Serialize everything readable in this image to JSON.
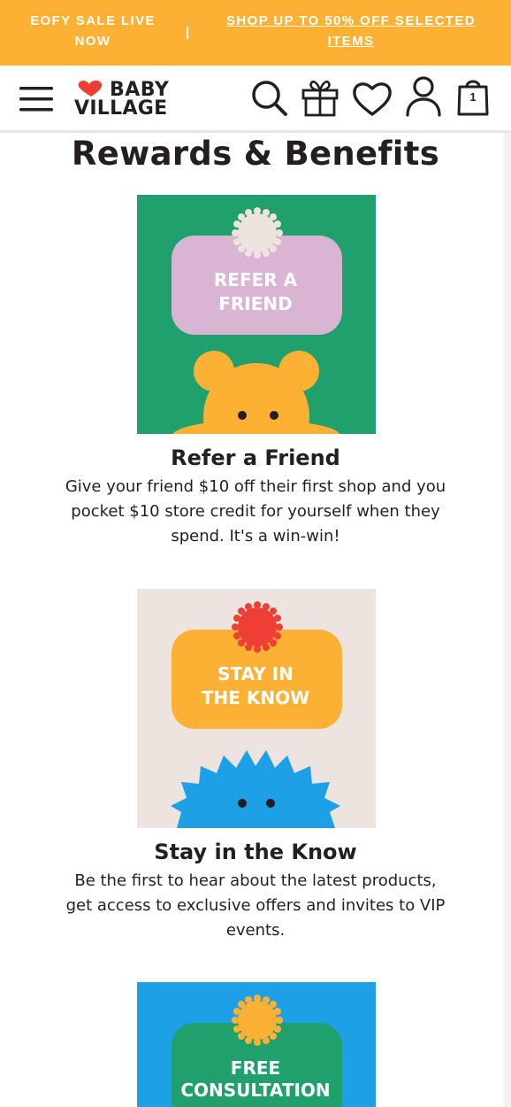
{
  "promo_bar": {
    "left_text": "EOFY SALE LIVE NOW",
    "right_link": "SHOP UP TO 50% OFF SELECTED ITEMS",
    "color": "#fcb034"
  },
  "header": {
    "logo_line1": "BABY",
    "logo_line2": "VILLAGE",
    "cart_count": "1",
    "icons": [
      "menu-icon",
      "search-icon",
      "gift-icon",
      "heart-icon",
      "account-icon",
      "cart-icon"
    ]
  },
  "page_title": "Rewards & Benefits",
  "cards": [
    {
      "image_label_line1": "REFER A",
      "image_label_line2": "FRIEND",
      "title": "Refer a Friend",
      "description": "Give your friend $10 off their first shop and you pocket $10 store credit for yourself when they spend. It's a win-win!",
      "bg_color": "#20a06c",
      "label_color": "#d9b4d3"
    },
    {
      "image_label_line1": "STAY IN",
      "image_label_line2": "THE KNOW",
      "title": "Stay in the Know",
      "description": "Be the first to hear about the latest products, get access to exclusive offers and invites to VIP events.",
      "bg_color": "#ede4df",
      "label_color": "#fcb034"
    },
    {
      "image_label_line1": "FREE",
      "image_label_line2": "CONSULTATION",
      "bg_color": "#1ea0e6",
      "label_color": "#20a06c"
    }
  ]
}
